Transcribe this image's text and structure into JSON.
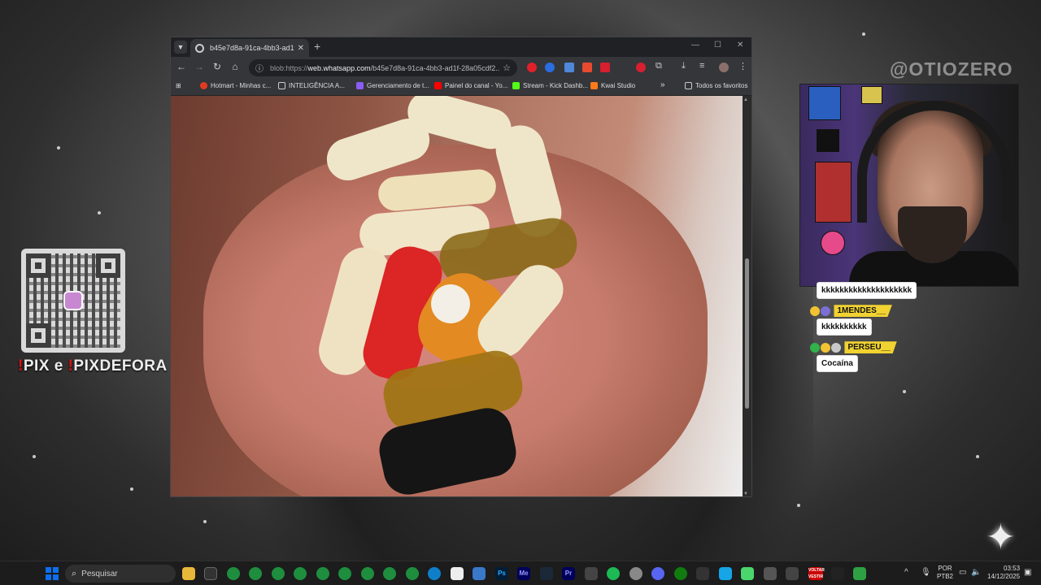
{
  "overlay": {
    "watermark": "@OTIOZERO",
    "pix_prefix_1": "!",
    "pix_word_1": "PIX e ",
    "pix_prefix_2": "!",
    "pix_word_2": "PIXDEFORA"
  },
  "chat": [
    {
      "user": "",
      "message": "kkkkkkkkkkkkkkkkkkkk"
    },
    {
      "user": "1MENDES__",
      "message": "kkkkkkkkkk"
    },
    {
      "user": "PERSEU__",
      "message": "Cocaína"
    }
  ],
  "browser": {
    "tab_title": "b45e7d8a-91ca-4bb3-ad1f-28a05cdf2",
    "url_prefix": "blob:https://",
    "url_host": "web.whatsapp.com",
    "url_path": "/b45e7d8a-91ca-4bb3-ad1f-28a05cdf2...",
    "new_tab": "+",
    "bookmarks": [
      {
        "label": "Hotmart - Minhas c...",
        "color": "#e5391f"
      },
      {
        "label": "INTELIGÊNCIA A...",
        "color": "#9aa0a6"
      },
      {
        "label": "Gerenciamento de t...",
        "color": "#9aa0a6"
      },
      {
        "label": "Painel do canal - Yo...",
        "color": "#ff0000"
      },
      {
        "label": "Stream - Kick Dashb...",
        "color": "#53fc18"
      },
      {
        "label": "Kwai Studio",
        "color": "#ff7a1a"
      }
    ],
    "bookmarks_overflow": "»",
    "all_bookmarks": "Todos os favoritos"
  },
  "taskbar": {
    "search_placeholder": "Pesquisar",
    "lang_line1": "POR",
    "lang_line2": "PTB2",
    "time": "03:53",
    "date": "14/12/2025",
    "vestir_badge": "VOLTAR VESTIR"
  },
  "colors": {
    "accent_blue": "#0b6ff0",
    "chat_user_bg": "#f1d231"
  }
}
